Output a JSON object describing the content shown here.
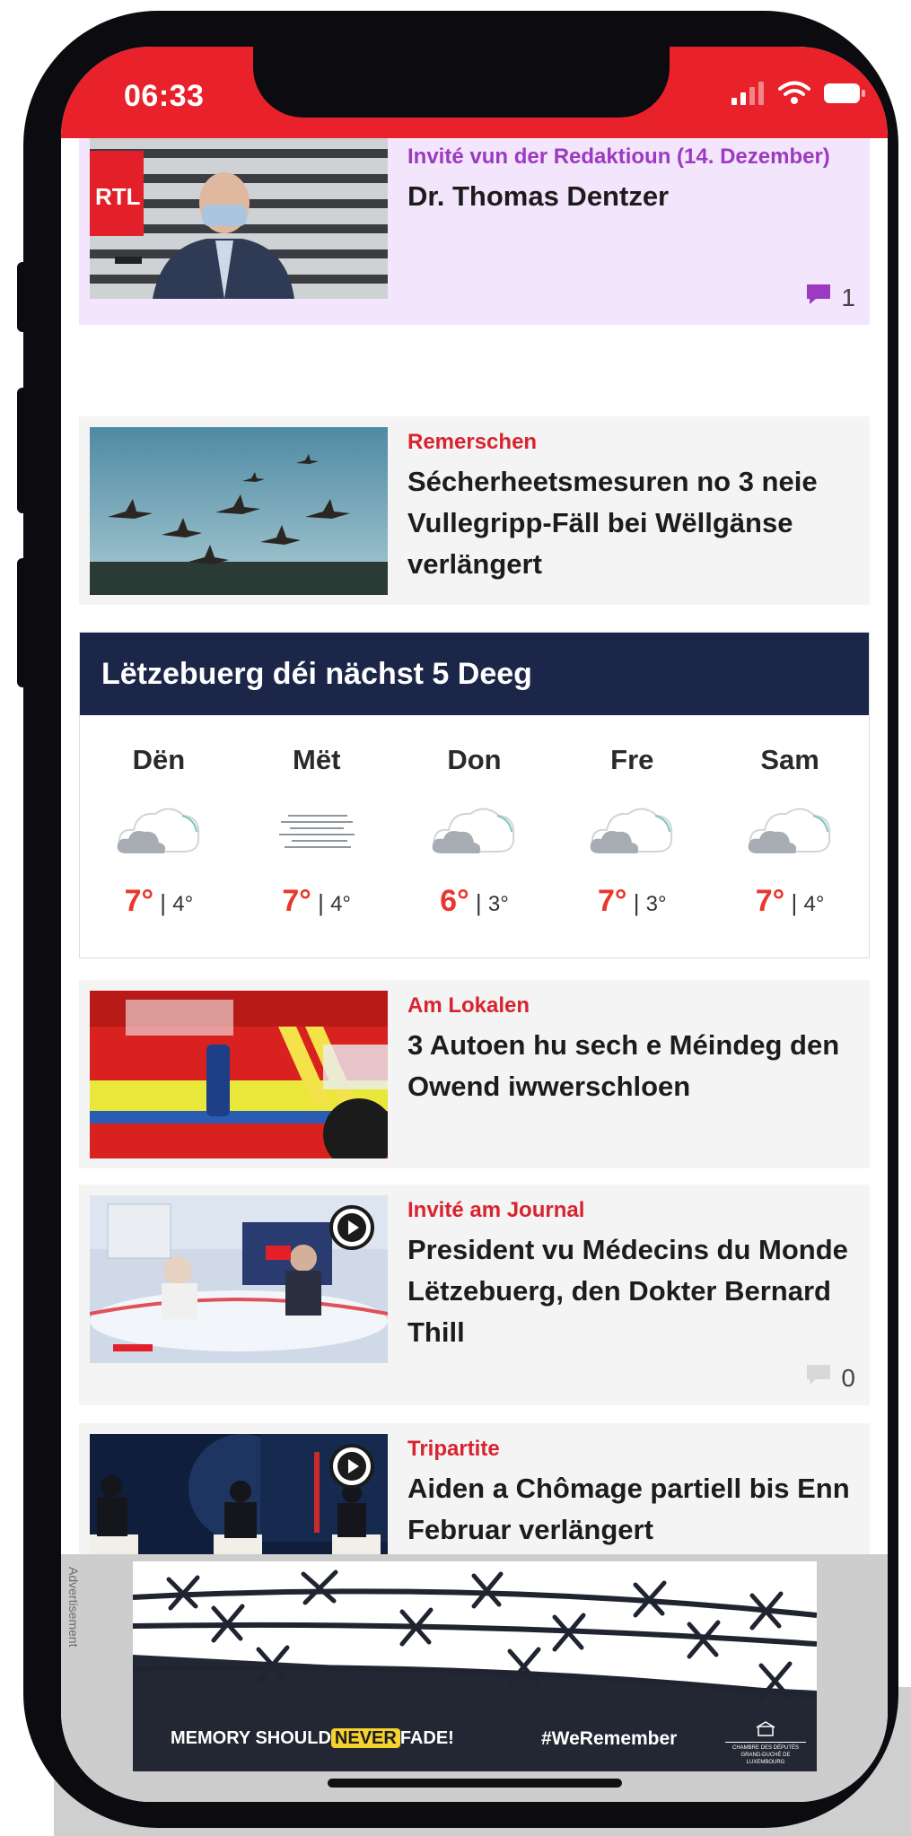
{
  "status_bar": {
    "time": "06:33",
    "color": "#e8212b"
  },
  "articles": [
    {
      "category": "Invité vun der Redaktioun (14. Dezember)",
      "title": "Dr. Thomas Dentzer",
      "comments": "1",
      "featured": true,
      "thumb": "man-in-mask-rtl-studio",
      "thumb_logo": "RTL"
    },
    {
      "category": "Remerschen",
      "title": "Sécherheetsmesuren no 3 neie Vullegripp-Fäll bei Wëllgänse verlängert",
      "thumb": "geese-flying"
    },
    {
      "category": "Am Lokalen",
      "title": "3 Autoen hu sech e Méindeg den Owend iwwerschloen",
      "thumb": "fire-truck"
    },
    {
      "category": "Invité am Journal",
      "title": "President vu Médecins du Monde Lëtzebuerg, den Dokter Bernard Thill",
      "comments": "0",
      "thumb": "tv-studio-interview",
      "video": true
    },
    {
      "category": "Tripartite",
      "title": "Aiden a Chômage partiell bis Enn Februar verlängert",
      "thumb": "press-conference",
      "video": true
    }
  ],
  "weather": {
    "heading": "Lëtzebuerg déi nächst 5 Deeg",
    "days": [
      {
        "name": "Dën",
        "icon": "cloud-icon",
        "high": "7°",
        "low": "4°"
      },
      {
        "name": "Mët",
        "icon": "fog-icon",
        "high": "7°",
        "low": "4°"
      },
      {
        "name": "Don",
        "icon": "cloud-icon",
        "high": "6°",
        "low": "3°"
      },
      {
        "name": "Fre",
        "icon": "cloud-icon",
        "high": "7°",
        "low": "3°"
      },
      {
        "name": "Sam",
        "icon": "cloud-icon",
        "high": "7°",
        "low": "4°"
      }
    ]
  },
  "ad": {
    "label": "Advertisement",
    "slogan_before": "MEMORY SHOULD",
    "slogan_highlight": "NEVER",
    "slogan_after": "FADE!",
    "hashtag": "#WeRemember",
    "sponsor_line1": "CHAMBRE DES DÉPUTÉS",
    "sponsor_line2": "GRAND-DUCHÉ DE LUXEMBOURG"
  }
}
